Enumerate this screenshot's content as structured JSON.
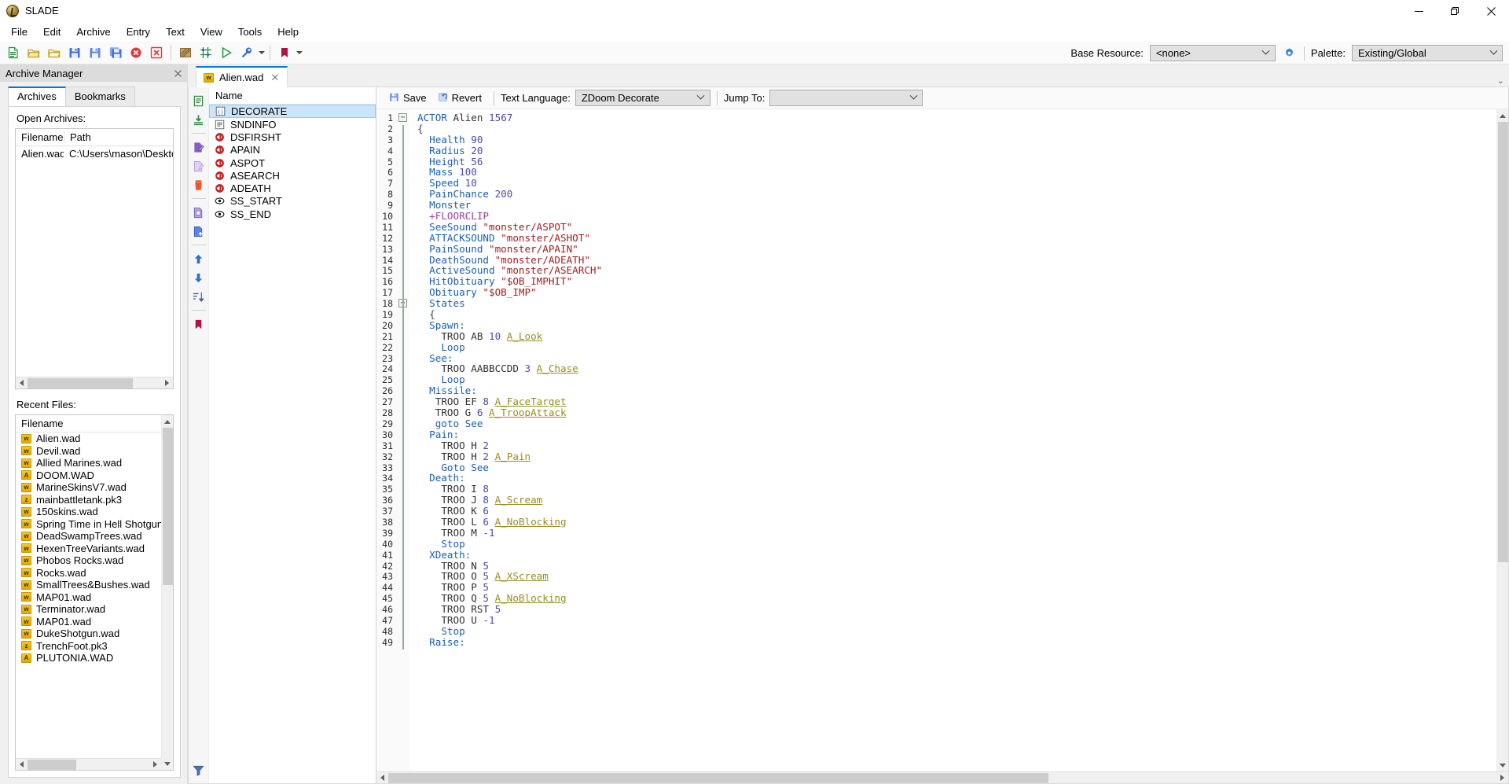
{
  "window": {
    "title": "SLADE",
    "logo_icon": "slade-logo-icon",
    "minimize_icon": "minimize-icon",
    "maximize_icon": "maximize-icon",
    "close_icon": "close-icon"
  },
  "menubar": {
    "items": [
      "File",
      "Edit",
      "Archive",
      "Entry",
      "Text",
      "View",
      "Tools",
      "Help"
    ]
  },
  "toolbar": {
    "buttons": [
      {
        "name": "new-archive-icon",
        "tip": "New Archive"
      },
      {
        "name": "open-archive-icon",
        "tip": "Open Archive"
      },
      {
        "name": "open-directory-icon",
        "tip": "Open Directory"
      },
      {
        "name": "save-archive-icon",
        "tip": "Save"
      },
      {
        "name": "save-as-icon",
        "tip": "Save As"
      },
      {
        "name": "save-all-icon",
        "tip": "Save All"
      },
      {
        "name": "close-archive-icon",
        "tip": "Close Archive"
      },
      {
        "name": "close-all-icon",
        "tip": "Close All"
      },
      {
        "name": "texture-editor-icon",
        "tip": "Texture Editor"
      },
      {
        "name": "map-editor-icon",
        "tip": "Map Editor"
      },
      {
        "name": "run-archive-icon",
        "tip": "Run Archive"
      },
      {
        "name": "maintenance-icon",
        "tip": "Maintenance"
      },
      {
        "name": "bookmarks-icon",
        "tip": "Bookmarks"
      }
    ],
    "base_resource_label": "Base Resource:",
    "base_resource_value": "<none>",
    "base_resource_settings_icon": "gear-icon",
    "palette_label": "Palette:",
    "palette_value": "Existing/Global"
  },
  "archive_manager": {
    "title": "Archive Manager",
    "close_icon": "close-icon",
    "tabs": [
      {
        "label": "Archives",
        "active": true
      },
      {
        "label": "Bookmarks",
        "active": false
      }
    ],
    "open_archives_label": "Open Archives:",
    "open_archives_columns": [
      "Filename",
      "Path"
    ],
    "open_archives_rows": [
      {
        "filename": "Alien.wad",
        "path": "C:\\Users\\mason\\Desktop\\"
      }
    ],
    "recent_files_label": "Recent Files:",
    "recent_files_column": "Filename",
    "recent_files": [
      {
        "name": "Alien.wad",
        "type": "wad"
      },
      {
        "name": "Devil.wad",
        "type": "wad"
      },
      {
        "name": "Allied Marines.wad",
        "type": "wad"
      },
      {
        "name": "DOOM.WAD",
        "type": "iwad"
      },
      {
        "name": "MarineSkinsV7.wad",
        "type": "wad"
      },
      {
        "name": "mainbattletank.pk3",
        "type": "pk3"
      },
      {
        "name": "150skins.wad",
        "type": "wad"
      },
      {
        "name": "Spring Time in Hell Shotgun.wa",
        "type": "wad"
      },
      {
        "name": "DeadSwampTrees.wad",
        "type": "wad"
      },
      {
        "name": "HexenTreeVariants.wad",
        "type": "wad"
      },
      {
        "name": "Phobos Rocks.wad",
        "type": "wad"
      },
      {
        "name": "Rocks.wad",
        "type": "wad"
      },
      {
        "name": "SmallTrees&Bushes.wad",
        "type": "wad"
      },
      {
        "name": "MAP01.wad",
        "type": "wad"
      },
      {
        "name": "Terminator.wad",
        "type": "wad"
      },
      {
        "name": "MAP01.wad",
        "type": "wad"
      },
      {
        "name": "DukeShotgun.wad",
        "type": "wad"
      },
      {
        "name": "TrenchFoot.pk3",
        "type": "pk3"
      },
      {
        "name": "PLUTONIA.WAD",
        "type": "iwad"
      }
    ]
  },
  "editor": {
    "tab": {
      "label": "Alien.wad",
      "icon": "wad-file-icon",
      "close_icon": "close-icon"
    },
    "entry_toolbar": [
      {
        "name": "new-entry-icon"
      },
      {
        "name": "import-entry-icon"
      },
      {
        "name": "rename-entry-icon"
      },
      {
        "name": "edit-entry-icon"
      },
      {
        "name": "delete-entry-icon"
      },
      {
        "name": "copy-entry-icon"
      },
      {
        "name": "paste-entry-icon"
      },
      {
        "name": "move-up-icon"
      },
      {
        "name": "move-down-icon"
      },
      {
        "name": "sort-entries-icon"
      },
      {
        "name": "bookmark-icon"
      }
    ],
    "filter_icon": "filter-icon",
    "entry_list_header": "Name",
    "entries": [
      {
        "name": "DECORATE",
        "icon": "text-code-icon",
        "selected": true
      },
      {
        "name": "SNDINFO",
        "icon": "text-icon",
        "selected": false
      },
      {
        "name": "DSFIRSHT",
        "icon": "sound-icon",
        "selected": false
      },
      {
        "name": "APAIN",
        "icon": "sound-icon",
        "selected": false
      },
      {
        "name": "ASPOT",
        "icon": "sound-icon",
        "selected": false
      },
      {
        "name": "ASEARCH",
        "icon": "sound-icon",
        "selected": false
      },
      {
        "name": "ADEATH",
        "icon": "sound-icon",
        "selected": false
      },
      {
        "name": "SS_START",
        "icon": "marker-icon",
        "selected": false
      },
      {
        "name": "SS_END",
        "icon": "marker-icon",
        "selected": false
      }
    ],
    "text_toolbar": {
      "save_label": "Save",
      "save_icon": "save-icon",
      "revert_label": "Revert",
      "revert_icon": "revert-icon",
      "text_language_label": "Text Language:",
      "text_language_value": "ZDoom Decorate",
      "jump_to_label": "Jump To:",
      "jump_to_value": ""
    }
  },
  "code": {
    "first_line": 1,
    "last_line": 49,
    "lines": [
      {
        "n": 1,
        "fold": "minus",
        "tokens": [
          {
            "t": "ACTOR",
            "c": "kw"
          },
          {
            "t": " ",
            "c": "plain"
          },
          {
            "t": "Alien",
            "c": "plain"
          },
          {
            "t": " ",
            "c": "plain"
          },
          {
            "t": "1567",
            "c": "num"
          }
        ]
      },
      {
        "n": 2,
        "tokens": [
          {
            "t": "{",
            "c": "brace"
          }
        ]
      },
      {
        "n": 3,
        "tokens": [
          {
            "t": "  Health",
            "c": "kw"
          },
          {
            "t": " ",
            "c": "plain"
          },
          {
            "t": "90",
            "c": "num"
          }
        ]
      },
      {
        "n": 4,
        "tokens": [
          {
            "t": "  Radius",
            "c": "kw"
          },
          {
            "t": " ",
            "c": "plain"
          },
          {
            "t": "20",
            "c": "num"
          }
        ]
      },
      {
        "n": 5,
        "tokens": [
          {
            "t": "  Height",
            "c": "kw"
          },
          {
            "t": " ",
            "c": "plain"
          },
          {
            "t": "56",
            "c": "num"
          }
        ]
      },
      {
        "n": 6,
        "tokens": [
          {
            "t": "  Mass",
            "c": "kw"
          },
          {
            "t": " ",
            "c": "plain"
          },
          {
            "t": "100",
            "c": "num"
          }
        ]
      },
      {
        "n": 7,
        "tokens": [
          {
            "t": "  Speed",
            "c": "kw"
          },
          {
            "t": " ",
            "c": "plain"
          },
          {
            "t": "10",
            "c": "num"
          }
        ]
      },
      {
        "n": 8,
        "tokens": [
          {
            "t": "  PainChance",
            "c": "kw"
          },
          {
            "t": " ",
            "c": "plain"
          },
          {
            "t": "200",
            "c": "num"
          }
        ]
      },
      {
        "n": 9,
        "tokens": [
          {
            "t": "  Monster",
            "c": "kw"
          }
        ]
      },
      {
        "n": 10,
        "tokens": [
          {
            "t": "  +FLOORCLIP",
            "c": "flag"
          }
        ]
      },
      {
        "n": 11,
        "tokens": [
          {
            "t": "  SeeSound",
            "c": "kw"
          },
          {
            "t": " ",
            "c": "plain"
          },
          {
            "t": "\"monster/ASPOT\"",
            "c": "str"
          }
        ]
      },
      {
        "n": 12,
        "tokens": [
          {
            "t": "  ATTACKSOUND",
            "c": "kw"
          },
          {
            "t": " ",
            "c": "plain"
          },
          {
            "t": "\"monster/ASHOT\"",
            "c": "str"
          }
        ]
      },
      {
        "n": 13,
        "tokens": [
          {
            "t": "  PainSound",
            "c": "kw"
          },
          {
            "t": " ",
            "c": "plain"
          },
          {
            "t": "\"monster/APAIN\"",
            "c": "str"
          }
        ]
      },
      {
        "n": 14,
        "tokens": [
          {
            "t": "  DeathSound",
            "c": "kw"
          },
          {
            "t": " ",
            "c": "plain"
          },
          {
            "t": "\"monster/ADEATH\"",
            "c": "str"
          }
        ]
      },
      {
        "n": 15,
        "tokens": [
          {
            "t": "  ActiveSound",
            "c": "kw"
          },
          {
            "t": " ",
            "c": "plain"
          },
          {
            "t": "\"monster/ASEARCH\"",
            "c": "str"
          }
        ]
      },
      {
        "n": 16,
        "tokens": [
          {
            "t": "  HitObituary",
            "c": "kw"
          },
          {
            "t": " ",
            "c": "plain"
          },
          {
            "t": "\"$OB_IMPHIT\"",
            "c": "str"
          }
        ]
      },
      {
        "n": 17,
        "tokens": [
          {
            "t": "  Obituary",
            "c": "kw"
          },
          {
            "t": " ",
            "c": "plain"
          },
          {
            "t": "\"$OB_IMP\"",
            "c": "str"
          }
        ]
      },
      {
        "n": 18,
        "fold": "minus",
        "tokens": [
          {
            "t": "  States",
            "c": "kw"
          }
        ]
      },
      {
        "n": 19,
        "tokens": [
          {
            "t": "  {",
            "c": "brace"
          }
        ]
      },
      {
        "n": 20,
        "tokens": [
          {
            "t": "  Spawn:",
            "c": "kw"
          }
        ]
      },
      {
        "n": 21,
        "tokens": [
          {
            "t": "    TROO AB ",
            "c": "plain"
          },
          {
            "t": "10",
            "c": "num"
          },
          {
            "t": " ",
            "c": "plain"
          },
          {
            "t": "A_Look",
            "c": "fn"
          }
        ]
      },
      {
        "n": 22,
        "tokens": [
          {
            "t": "    Loop",
            "c": "kw"
          }
        ]
      },
      {
        "n": 23,
        "tokens": [
          {
            "t": "  See:",
            "c": "kw"
          }
        ]
      },
      {
        "n": 24,
        "tokens": [
          {
            "t": "    TROO AABBCCDD ",
            "c": "plain"
          },
          {
            "t": "3",
            "c": "num"
          },
          {
            "t": " ",
            "c": "plain"
          },
          {
            "t": "A_Chase",
            "c": "fn"
          }
        ]
      },
      {
        "n": 25,
        "tokens": [
          {
            "t": "    Loop",
            "c": "kw"
          }
        ]
      },
      {
        "n": 26,
        "tokens": [
          {
            "t": "  Missile:",
            "c": "kw"
          }
        ]
      },
      {
        "n": 27,
        "tokens": [
          {
            "t": "   TROO EF ",
            "c": "plain"
          },
          {
            "t": "8",
            "c": "num"
          },
          {
            "t": " ",
            "c": "plain"
          },
          {
            "t": "A_FaceTarget",
            "c": "fn"
          }
        ]
      },
      {
        "n": 28,
        "tokens": [
          {
            "t": "   TROO G ",
            "c": "plain"
          },
          {
            "t": "6",
            "c": "num"
          },
          {
            "t": " ",
            "c": "plain"
          },
          {
            "t": "A_TroopAttack",
            "c": "fn"
          }
        ]
      },
      {
        "n": 29,
        "tokens": [
          {
            "t": "   goto See",
            "c": "kw"
          }
        ]
      },
      {
        "n": 30,
        "tokens": [
          {
            "t": "  Pain:",
            "c": "kw"
          }
        ]
      },
      {
        "n": 31,
        "tokens": [
          {
            "t": "    TROO H ",
            "c": "plain"
          },
          {
            "t": "2",
            "c": "num"
          }
        ]
      },
      {
        "n": 32,
        "tokens": [
          {
            "t": "    TROO H ",
            "c": "plain"
          },
          {
            "t": "2",
            "c": "num"
          },
          {
            "t": " ",
            "c": "plain"
          },
          {
            "t": "A_Pain",
            "c": "fn"
          }
        ]
      },
      {
        "n": 33,
        "tokens": [
          {
            "t": "    Goto See",
            "c": "kw"
          }
        ]
      },
      {
        "n": 34,
        "tokens": [
          {
            "t": "  Death:",
            "c": "kw"
          }
        ]
      },
      {
        "n": 35,
        "tokens": [
          {
            "t": "    TROO I ",
            "c": "plain"
          },
          {
            "t": "8",
            "c": "num"
          }
        ]
      },
      {
        "n": 36,
        "tokens": [
          {
            "t": "    TROO J ",
            "c": "plain"
          },
          {
            "t": "8",
            "c": "num"
          },
          {
            "t": " ",
            "c": "plain"
          },
          {
            "t": "A_Scream",
            "c": "fn"
          }
        ]
      },
      {
        "n": 37,
        "tokens": [
          {
            "t": "    TROO K ",
            "c": "plain"
          },
          {
            "t": "6",
            "c": "num"
          }
        ]
      },
      {
        "n": 38,
        "tokens": [
          {
            "t": "    TROO L ",
            "c": "plain"
          },
          {
            "t": "6",
            "c": "num"
          },
          {
            "t": " ",
            "c": "plain"
          },
          {
            "t": "A_NoBlocking",
            "c": "fn"
          }
        ]
      },
      {
        "n": 39,
        "tokens": [
          {
            "t": "    TROO M ",
            "c": "plain"
          },
          {
            "t": "-1",
            "c": "num"
          }
        ]
      },
      {
        "n": 40,
        "tokens": [
          {
            "t": "    Stop",
            "c": "kw"
          }
        ]
      },
      {
        "n": 41,
        "tokens": [
          {
            "t": "  XDeath:",
            "c": "kw"
          }
        ]
      },
      {
        "n": 42,
        "tokens": [
          {
            "t": "    TROO N ",
            "c": "plain"
          },
          {
            "t": "5",
            "c": "num"
          }
        ]
      },
      {
        "n": 43,
        "tokens": [
          {
            "t": "    TROO O ",
            "c": "plain"
          },
          {
            "t": "5",
            "c": "num"
          },
          {
            "t": " ",
            "c": "plain"
          },
          {
            "t": "A_XScream",
            "c": "fn"
          }
        ]
      },
      {
        "n": 44,
        "tokens": [
          {
            "t": "    TROO P ",
            "c": "plain"
          },
          {
            "t": "5",
            "c": "num"
          }
        ]
      },
      {
        "n": 45,
        "tokens": [
          {
            "t": "    TROO Q ",
            "c": "plain"
          },
          {
            "t": "5",
            "c": "num"
          },
          {
            "t": " ",
            "c": "plain"
          },
          {
            "t": "A_NoBlocking",
            "c": "fn"
          }
        ]
      },
      {
        "n": 46,
        "tokens": [
          {
            "t": "    TROO RST ",
            "c": "plain"
          },
          {
            "t": "5",
            "c": "num"
          }
        ]
      },
      {
        "n": 47,
        "tokens": [
          {
            "t": "    TROO U ",
            "c": "plain"
          },
          {
            "t": "-1",
            "c": "num"
          }
        ]
      },
      {
        "n": 48,
        "tokens": [
          {
            "t": "    Stop",
            "c": "kw"
          }
        ]
      },
      {
        "n": 49,
        "tokens": [
          {
            "t": "  Raise:",
            "c": "kw"
          }
        ]
      }
    ]
  },
  "colors": {
    "accent": "#0078d7",
    "selection": "#cce4f7",
    "keyword": "#1a5fb4",
    "string": "#a02020",
    "number": "#4a4ab0",
    "function": "#9a8c20",
    "flag": "#a040a0"
  }
}
